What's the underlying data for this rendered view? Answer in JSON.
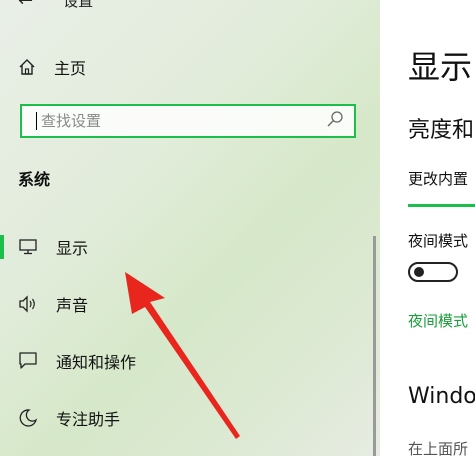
{
  "window": {
    "title": "设置",
    "back_icon": "back-arrow-icon"
  },
  "sidebar": {
    "home_label": "主页",
    "search": {
      "placeholder": "查找设置",
      "value": ""
    },
    "section_title": "系统",
    "items": [
      {
        "label": "显示",
        "icon": "monitor-icon",
        "active": true
      },
      {
        "label": "声音",
        "icon": "speaker-icon",
        "active": false
      },
      {
        "label": "通知和操作",
        "icon": "notification-icon",
        "active": false
      },
      {
        "label": "专注助手",
        "icon": "moon-icon",
        "active": false
      }
    ]
  },
  "content": {
    "page_title": "显示",
    "brightness_title": "亮度和",
    "brightness_desc": "更改内置",
    "night_light_label": "夜间模式",
    "night_light_link": "夜间模式",
    "windows_title": "Windo",
    "windows_desc": "在上面所"
  },
  "colors": {
    "accent": "#1dbf4c",
    "link": "#1a9e3c",
    "annotation_arrow": "#e8261e"
  }
}
